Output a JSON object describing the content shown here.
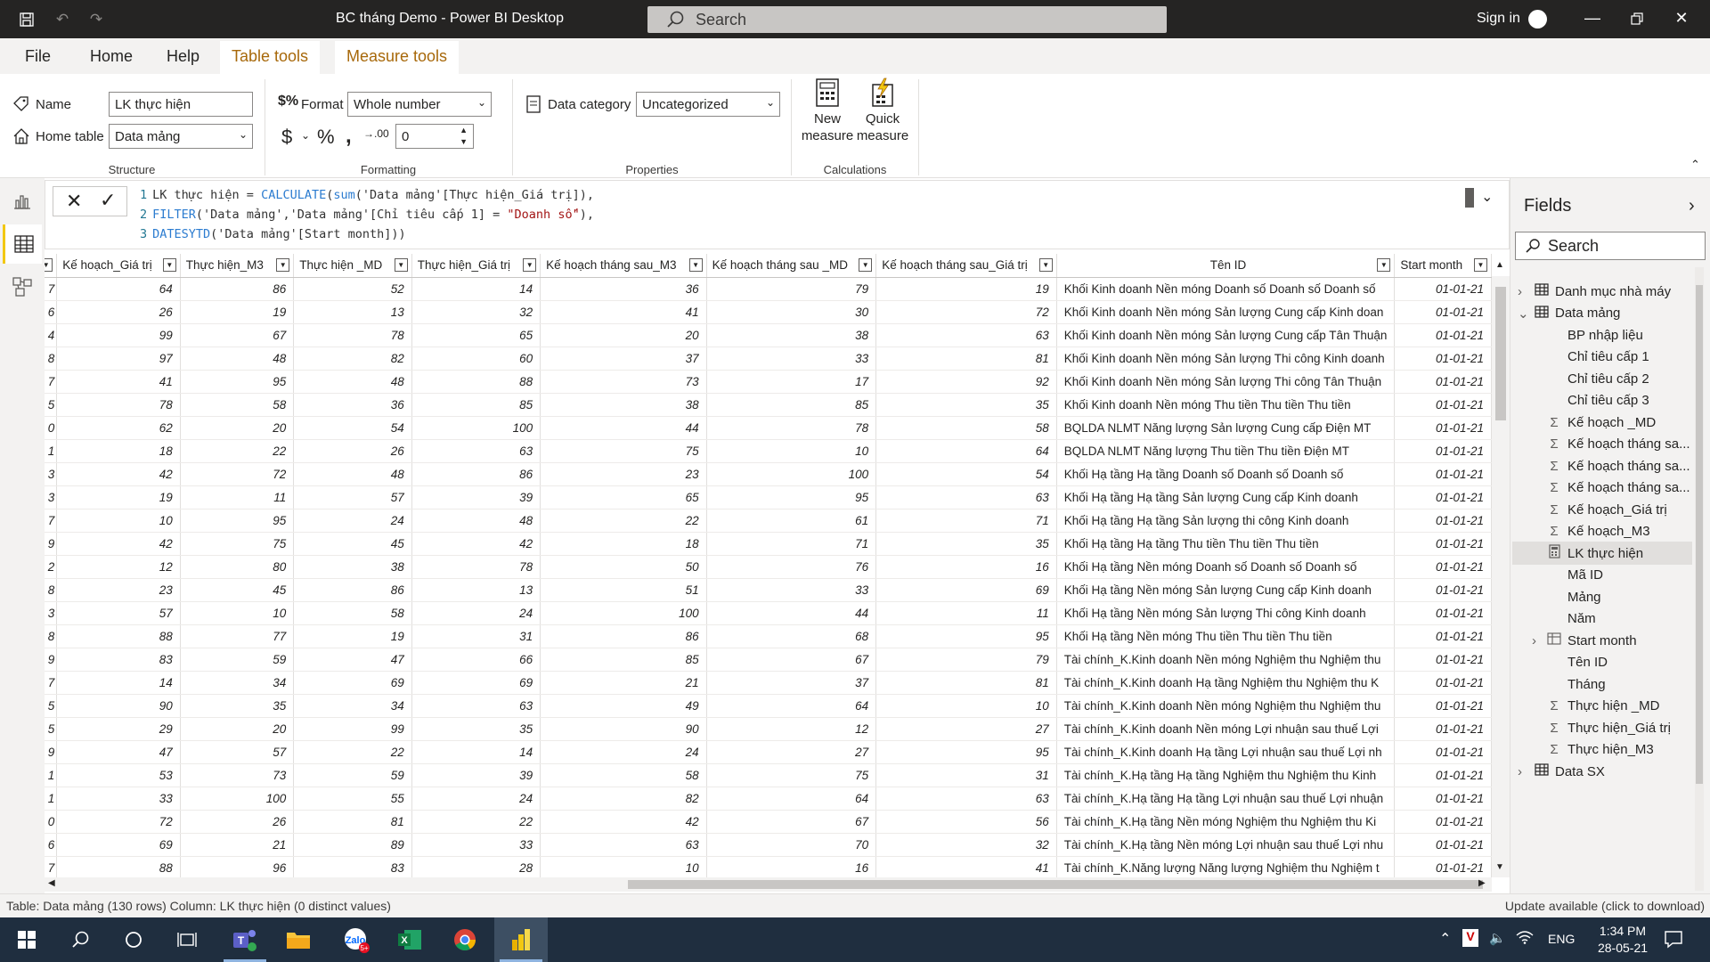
{
  "window": {
    "title": "BC tháng Demo - Power BI Desktop",
    "search_placeholder": "Search",
    "sign_in": "Sign in"
  },
  "ribbon_tabs": [
    "File",
    "Home",
    "Help",
    "Table tools",
    "Measure tools"
  ],
  "ribbon": {
    "structure": {
      "name_label": "Name",
      "name_value": "LK thực hiện",
      "home_table_label": "Home table",
      "home_table_value": "Data mảng",
      "group_label": "Structure"
    },
    "formatting": {
      "format_label": "Format",
      "format_value": "Whole number",
      "decimals_value": "0",
      "group_label": "Formatting"
    },
    "properties": {
      "data_category_label": "Data category",
      "data_category_value": "Uncategorized",
      "group_label": "Properties"
    },
    "calculations": {
      "new_measure_line1": "New",
      "new_measure_line2": "measure",
      "quick_measure_line1": "Quick",
      "quick_measure_line2": "measure",
      "group_label": "Calculations"
    }
  },
  "formula": {
    "line1_num": "1",
    "line1_a": "LK thực hiện = ",
    "line1_fn": "CALCULATE",
    "line1_b": "(",
    "line1_fn2": "sum",
    "line1_c": "('Data mảng'[Thực hiện_Giá trị]),",
    "line2_num": "2",
    "line2_fn": "FILTER",
    "line2_a": "('Data mảng','Data mảng'[Chỉ tiêu cấp 1] = ",
    "line2_str": "\"Doanh số\"",
    "line2_b": "),",
    "line3_num": "3",
    "line3_fn": "DATESYTD",
    "line3_a": "('Data mảng'[Start month]))"
  },
  "table": {
    "columns": [
      "",
      "Kế hoạch_Giá trị",
      "Thực hiện_M3",
      "Thực hiện _MD",
      "Thực hiện_Giá trị",
      "Kế hoạch tháng sau_M3",
      "Kế hoạch tháng sau _MD",
      "Kế hoạch tháng sau_Giá trị",
      "Tên ID",
      "Start month"
    ],
    "rows": [
      [
        "7",
        "64",
        "86",
        "52",
        "14",
        "36",
        "79",
        "19",
        "Khối Kinh doanh Nền móng Doanh số Doanh số Doanh số",
        "01-01-21"
      ],
      [
        "6",
        "26",
        "19",
        "13",
        "32",
        "41",
        "30",
        "72",
        "Khối Kinh doanh Nền móng Sản lượng Cung cấp Kinh doan",
        "01-01-21"
      ],
      [
        "4",
        "99",
        "67",
        "78",
        "65",
        "20",
        "38",
        "63",
        "Khối Kinh doanh Nền móng Sản lượng Cung cấp Tân Thuận",
        "01-01-21"
      ],
      [
        "8",
        "97",
        "48",
        "82",
        "60",
        "37",
        "33",
        "81",
        "Khối Kinh doanh Nền móng Sản lượng Thi công Kinh doanh",
        "01-01-21"
      ],
      [
        "7",
        "41",
        "95",
        "48",
        "88",
        "73",
        "17",
        "92",
        "Khối Kinh doanh Nền móng Sản lượng Thi công Tân Thuận",
        "01-01-21"
      ],
      [
        "5",
        "78",
        "58",
        "36",
        "85",
        "38",
        "85",
        "35",
        "Khối Kinh doanh Nền móng Thu tiền Thu tiền Thu tiền",
        "01-01-21"
      ],
      [
        "0",
        "62",
        "20",
        "54",
        "100",
        "44",
        "78",
        "58",
        "BQLDA NLMT Năng lượng Sản lượng Cung cấp Điện MT",
        "01-01-21"
      ],
      [
        "1",
        "18",
        "22",
        "26",
        "63",
        "75",
        "10",
        "64",
        "BQLDA NLMT Năng lượng Thu tiền Thu tiền Điện MT",
        "01-01-21"
      ],
      [
        "3",
        "42",
        "72",
        "48",
        "86",
        "23",
        "100",
        "54",
        "Khối Hạ tầng Hạ tầng Doanh số Doanh số Doanh số",
        "01-01-21"
      ],
      [
        "3",
        "19",
        "11",
        "57",
        "39",
        "65",
        "95",
        "63",
        "Khối Hạ tầng Hạ tầng Sản lượng Cung cấp Kinh doanh",
        "01-01-21"
      ],
      [
        "7",
        "10",
        "95",
        "24",
        "48",
        "22",
        "61",
        "71",
        "Khối Hạ tầng Hạ tầng Sản lượng thi công Kinh doanh",
        "01-01-21"
      ],
      [
        "9",
        "42",
        "75",
        "45",
        "42",
        "18",
        "71",
        "35",
        "Khối Hạ tầng Hạ tầng Thu tiền Thu tiền Thu tiền",
        "01-01-21"
      ],
      [
        "2",
        "12",
        "80",
        "38",
        "78",
        "50",
        "76",
        "16",
        "Khối Hạ tầng Nền móng Doanh số Doanh số Doanh số",
        "01-01-21"
      ],
      [
        "8",
        "23",
        "45",
        "86",
        "13",
        "51",
        "33",
        "69",
        "Khối Hạ tầng Nền móng Sản lượng Cung cấp Kinh doanh",
        "01-01-21"
      ],
      [
        "3",
        "57",
        "10",
        "58",
        "24",
        "100",
        "44",
        "11",
        "Khối Hạ tầng Nền móng Sản lượng Thi công Kinh doanh",
        "01-01-21"
      ],
      [
        "8",
        "88",
        "77",
        "19",
        "31",
        "86",
        "68",
        "95",
        "Khối Hạ tầng Nền móng Thu tiền Thu tiền Thu tiền",
        "01-01-21"
      ],
      [
        "9",
        "83",
        "59",
        "47",
        "66",
        "85",
        "67",
        "79",
        "Tài chính_K.Kinh doanh Nền móng Nghiệm thu Nghiệm thu",
        "01-01-21"
      ],
      [
        "7",
        "14",
        "34",
        "69",
        "69",
        "21",
        "37",
        "81",
        "Tài chính_K.Kinh doanh Hạ tầng Nghiệm thu Nghiệm thu K",
        "01-01-21"
      ],
      [
        "5",
        "90",
        "35",
        "34",
        "63",
        "49",
        "64",
        "10",
        "Tài chính_K.Kinh doanh Nền móng Nghiệm thu Nghiệm thu",
        "01-01-21"
      ],
      [
        "5",
        "29",
        "20",
        "99",
        "35",
        "90",
        "12",
        "27",
        "Tài chính_K.Kinh doanh Nền móng Lợi nhuận sau thuế Lợi",
        "01-01-21"
      ],
      [
        "9",
        "47",
        "57",
        "22",
        "14",
        "24",
        "27",
        "95",
        "Tài chính_K.Kinh doanh Hạ tầng Lợi nhuận sau thuế Lợi nh",
        "01-01-21"
      ],
      [
        "1",
        "53",
        "73",
        "59",
        "39",
        "58",
        "75",
        "31",
        "Tài chính_K.Hạ tầng Hạ tầng Nghiệm thu Nghiệm thu Kinh",
        "01-01-21"
      ],
      [
        "1",
        "33",
        "100",
        "55",
        "24",
        "82",
        "64",
        "63",
        "Tài chính_K.Hạ tầng Hạ tầng Lợi nhuận sau thuế Lợi nhuận",
        "01-01-21"
      ],
      [
        "0",
        "72",
        "26",
        "81",
        "22",
        "42",
        "67",
        "56",
        "Tài chính_K.Hạ tầng Nền móng Nghiệm thu Nghiệm thu Ki",
        "01-01-21"
      ],
      [
        "6",
        "69",
        "21",
        "89",
        "33",
        "63",
        "70",
        "32",
        "Tài chính_K.Hạ tầng Nền móng Lợi nhuận sau thuế Lợi nhu",
        "01-01-21"
      ],
      [
        "7",
        "88",
        "96",
        "83",
        "28",
        "10",
        "16",
        "41",
        "Tài chính_K.Năng lượng Năng lượng Nghiệm thu Nghiệm t",
        "01-01-21"
      ]
    ]
  },
  "status": {
    "left": "Table: Data mảng (130 rows) Column: LK thực hiện (0 distinct values)",
    "right": "Update available (click to download)"
  },
  "fields": {
    "title": "Fields",
    "search_placeholder": "Search",
    "items": [
      {
        "label": "Danh mục nhà máy",
        "type": "table",
        "expand": "›",
        "indent": 0
      },
      {
        "label": "Data mảng",
        "type": "table",
        "expand": "⌄",
        "indent": 0
      },
      {
        "label": "BP nhập liệu",
        "type": "field",
        "indent": 1
      },
      {
        "label": "Chỉ tiêu cấp 1",
        "type": "field",
        "indent": 1
      },
      {
        "label": "Chỉ tiêu cấp 2",
        "type": "field",
        "indent": 1
      },
      {
        "label": "Chỉ tiêu cấp 3",
        "type": "field",
        "indent": 1
      },
      {
        "label": "Kế hoạch _MD",
        "type": "sum",
        "indent": 1
      },
      {
        "label": "Kế hoạch tháng sa...",
        "type": "sum",
        "indent": 1
      },
      {
        "label": "Kế hoạch tháng sa...",
        "type": "sum",
        "indent": 1
      },
      {
        "label": "Kế hoạch tháng sa...",
        "type": "sum",
        "indent": 1
      },
      {
        "label": "Kế hoạch_Giá trị",
        "type": "sum",
        "indent": 1
      },
      {
        "label": "Kế hoạch_M3",
        "type": "sum",
        "indent": 1
      },
      {
        "label": "LK thực hiện",
        "type": "measure",
        "indent": 1,
        "selected": true
      },
      {
        "label": "Mã ID",
        "type": "field",
        "indent": 1
      },
      {
        "label": "Mảng",
        "type": "field",
        "indent": 1
      },
      {
        "label": "Năm",
        "type": "field",
        "indent": 1
      },
      {
        "label": "Start month",
        "type": "date",
        "expand": "›",
        "indent": 1
      },
      {
        "label": "Tên ID",
        "type": "field",
        "indent": 1
      },
      {
        "label": "Tháng",
        "type": "field",
        "indent": 1
      },
      {
        "label": "Thực hiện _MD",
        "type": "sum",
        "indent": 1
      },
      {
        "label": "Thực hiện_Giá trị",
        "type": "sum",
        "indent": 1
      },
      {
        "label": "Thực hiện_M3",
        "type": "sum",
        "indent": 1
      },
      {
        "label": "Data SX",
        "type": "table",
        "expand": "›",
        "indent": 0
      }
    ]
  },
  "taskbar": {
    "time": "1:34 PM",
    "date": "28-05-21",
    "lang": "ENG"
  },
  "colors": {
    "accent_yellow": "#f2c811",
    "title_bar": "#252423",
    "selected_tab_text": "#a7680a",
    "taskbar": "#1f2e3f"
  }
}
